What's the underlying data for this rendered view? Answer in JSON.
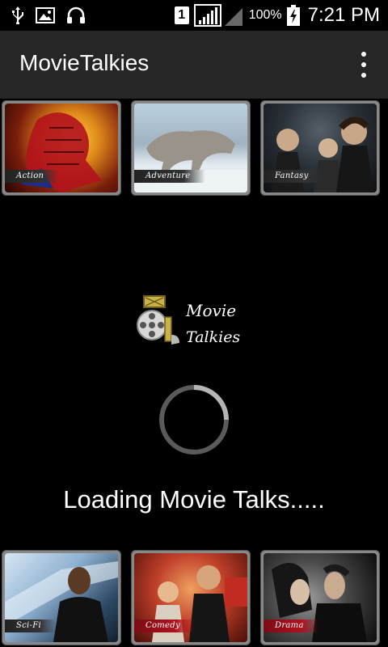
{
  "status_bar": {
    "time": "7:21 PM",
    "battery_pct": "100%",
    "sim_slot": "1",
    "icons": [
      "usb-icon",
      "image-icon",
      "headphones-icon",
      "sim-icon",
      "signal-icon",
      "battery-charging-icon"
    ]
  },
  "action_bar": {
    "title": "MovieTalkies",
    "overflow_icon": "overflow-menu-icon"
  },
  "genres_top": [
    {
      "label": "Action"
    },
    {
      "label": "Adventure"
    },
    {
      "label": "Fantasy"
    }
  ],
  "genres_bottom": [
    {
      "label": "Sci-Fi"
    },
    {
      "label": "Comedy"
    },
    {
      "label": "Drama"
    }
  ],
  "logo": {
    "line1": "Movie",
    "line2": "Talkies"
  },
  "loading": {
    "text": "Loading Movie Talks....."
  },
  "colors": {
    "action_bar": "#262626",
    "background": "#000000",
    "label_red": "#b0121e"
  }
}
